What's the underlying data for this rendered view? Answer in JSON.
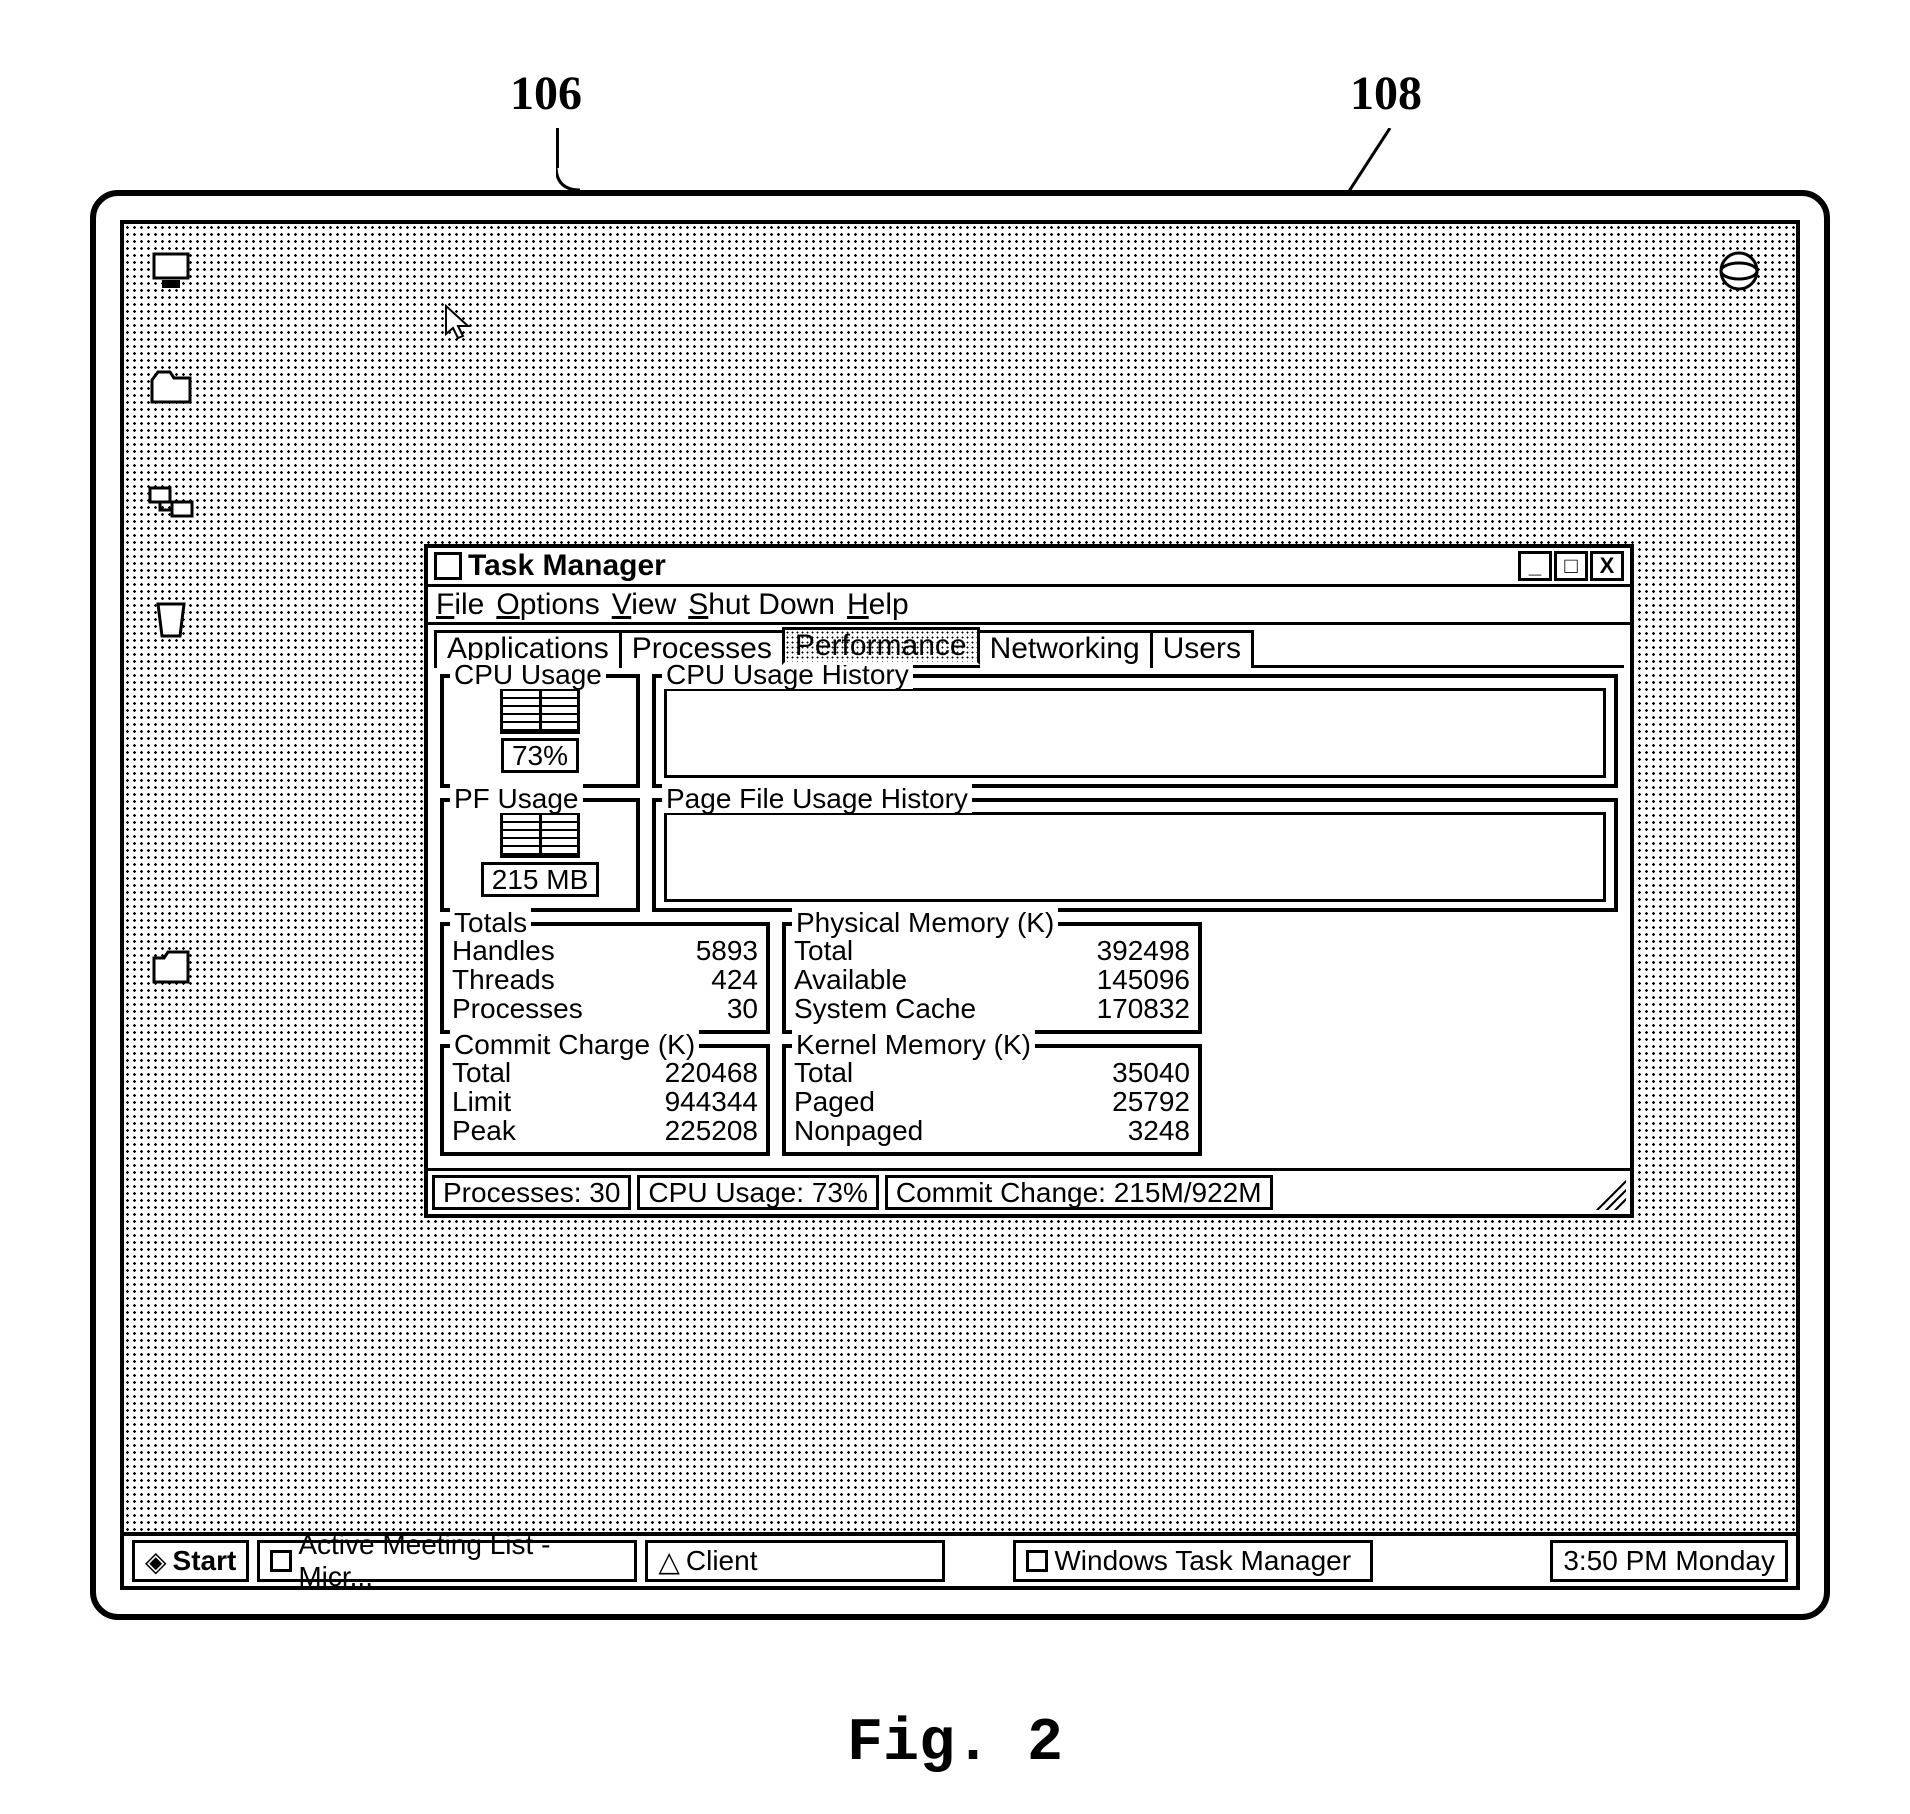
{
  "callouts": {
    "left": "106",
    "right": "108"
  },
  "figure_caption": "Fig. 2",
  "desktop": {
    "icons": [
      {
        "name": "my-computer-icon"
      },
      {
        "name": "folder-icon"
      },
      {
        "name": "network-icon"
      },
      {
        "name": "recycle-bin-icon"
      },
      {
        "name": "documents-icon"
      },
      {
        "name": "internet-icon"
      }
    ]
  },
  "window": {
    "title": "Task Manager",
    "controls": {
      "minimize": "_",
      "maximize": "□",
      "close": "X"
    },
    "menu": [
      {
        "pre": "",
        "ul": "F",
        "post": "ile"
      },
      {
        "pre": "",
        "ul": "O",
        "post": "ptions"
      },
      {
        "pre": "",
        "ul": "V",
        "post": "iew"
      },
      {
        "pre": "",
        "ul": "S",
        "post": "hut Down"
      },
      {
        "pre": "",
        "ul": "H",
        "post": "elp"
      }
    ],
    "tabs": [
      {
        "label": "Applications",
        "active": false
      },
      {
        "label": "Processes",
        "active": false
      },
      {
        "label": "Performance",
        "active": true
      },
      {
        "label": "Networking",
        "active": false
      },
      {
        "label": "Users",
        "active": false
      }
    ],
    "cpu": {
      "group_label": "CPU Usage",
      "value": "73%",
      "history_label": "CPU Usage History"
    },
    "pf": {
      "group_label": "PF Usage",
      "value": "215 MB",
      "history_label": "Page File Usage History"
    },
    "totals": {
      "group_label": "Totals",
      "rows": [
        {
          "k": "Handles",
          "v": "5893"
        },
        {
          "k": "Threads",
          "v": "424"
        },
        {
          "k": "Processes",
          "v": "30"
        }
      ]
    },
    "physical": {
      "group_label": "Physical Memory (K)",
      "rows": [
        {
          "k": "Total",
          "v": "392498"
        },
        {
          "k": "Available",
          "v": "145096"
        },
        {
          "k": "System Cache",
          "v": "170832"
        }
      ]
    },
    "commit": {
      "group_label": "Commit Charge (K)",
      "rows": [
        {
          "k": "Total",
          "v": "220468"
        },
        {
          "k": "Limit",
          "v": "944344"
        },
        {
          "k": "Peak",
          "v": "225208"
        }
      ]
    },
    "kernel": {
      "group_label": "Kernel Memory (K)",
      "rows": [
        {
          "k": "Total",
          "v": "35040"
        },
        {
          "k": "Paged",
          "v": "25792"
        },
        {
          "k": "Nonpaged",
          "v": "3248"
        }
      ]
    },
    "status": {
      "processes": "Processes: 30",
      "cpu": "CPU Usage: 73%",
      "commit": "Commit Change: 215M/922M"
    }
  },
  "taskbar": {
    "start": "Start",
    "items": [
      {
        "label": "Active Meeting List -Micr..."
      },
      {
        "label": "Client"
      },
      {
        "label": "Windows Task Manager"
      }
    ],
    "clock": "3:50 PM Monday"
  }
}
